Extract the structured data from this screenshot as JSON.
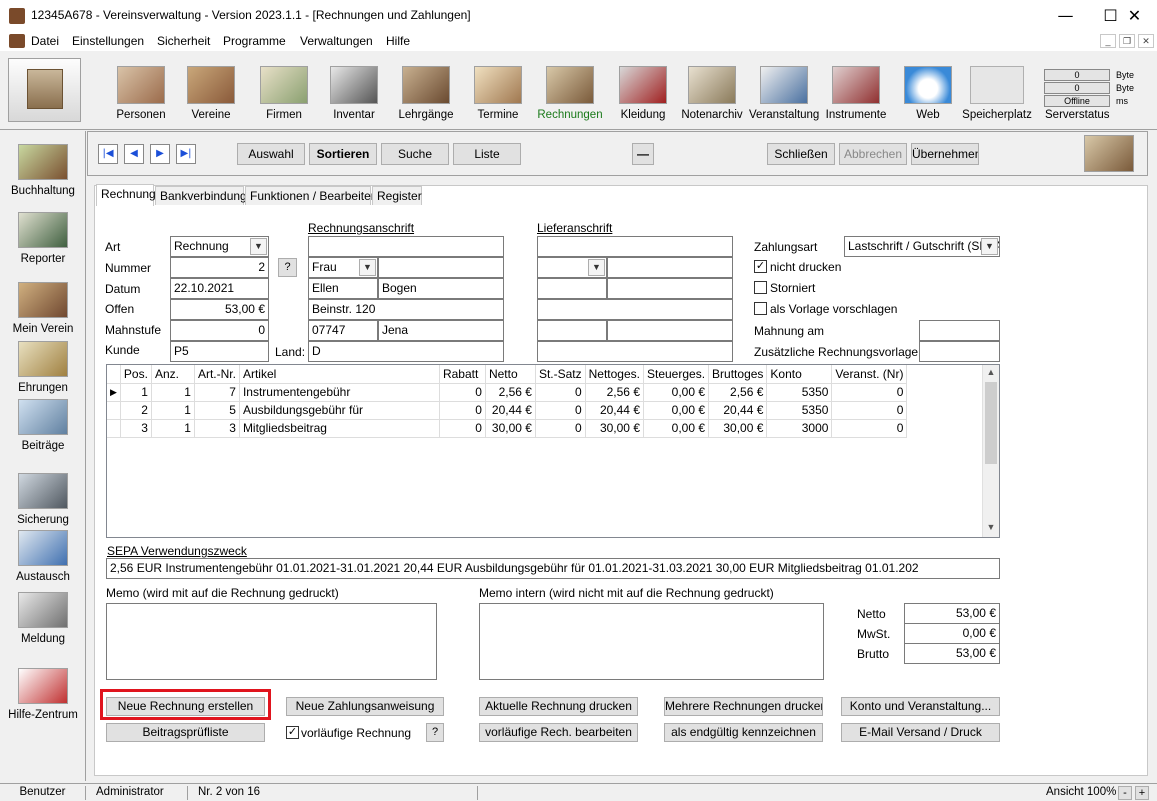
{
  "window": {
    "title": "12345A678 - Vereinsverwaltung - Version 2023.1.1 - [Rechnungen und Zahlungen]",
    "minimize": "—",
    "maximize": "☐",
    "close": "✕"
  },
  "menu": {
    "items": [
      "Datei",
      "Einstellungen",
      "Sicherheit",
      "Programme",
      "Verwaltungen",
      "Hilfe"
    ]
  },
  "toolbar": {
    "items": [
      {
        "label": "Personen",
        "icon": "people-icon"
      },
      {
        "label": "Vereine",
        "icon": "group-icon"
      },
      {
        "label": "Firmen",
        "icon": "building-icon"
      },
      {
        "label": "Inventar",
        "icon": "inventory-icon"
      },
      {
        "label": "Lehrgänge",
        "icon": "course-icon"
      },
      {
        "label": "Termine",
        "icon": "calendar-icon"
      },
      {
        "label": "Rechnungen",
        "icon": "cash-register-icon"
      },
      {
        "label": "Kleidung",
        "icon": "clothing-icon"
      },
      {
        "label": "Notenarchiv",
        "icon": "sheet-music-icon"
      },
      {
        "label": "Veranstaltung",
        "icon": "event-icon"
      },
      {
        "label": "Instrumente",
        "icon": "instruments-icon"
      },
      {
        "label": "Web",
        "icon": "cloud-icon"
      },
      {
        "label": "Speicherplatz",
        "icon": "storage-icon"
      }
    ],
    "server": {
      "label": "Serverstatus",
      "val1": "0",
      "unit1": "Byte",
      "val2": "0",
      "unit2": "Byte",
      "val3": "Offline",
      "unit3": "ms"
    }
  },
  "sidebar": {
    "items": [
      {
        "label": "Buchhaltung",
        "icon": "accounting-icon"
      },
      {
        "label": "Reporter",
        "icon": "reporter-icon"
      },
      {
        "label": "Mein Verein",
        "icon": "club-icon"
      },
      {
        "label": "Ehrungen",
        "icon": "honors-icon"
      },
      {
        "label": "Beiträge",
        "icon": "fees-icon"
      },
      {
        "label": "Sicherung",
        "icon": "backup-icon"
      },
      {
        "label": "Austausch",
        "icon": "exchange-icon"
      },
      {
        "label": "Meldung",
        "icon": "report-icon"
      },
      {
        "label": "Hilfe-Zentrum",
        "icon": "ambulance-icon"
      }
    ]
  },
  "nav": {
    "first": "|◀",
    "prev": "◀",
    "next": "▶",
    "last": "▶|",
    "auswahl": "Auswahl",
    "sortieren": "Sortieren",
    "suche": "Suche",
    "liste": "Liste",
    "minus": "—",
    "schliessen": "Schließen",
    "abbrechen": "Abbrechen",
    "uebernehmen": "Übernehmen"
  },
  "tabs": [
    "Rechnung",
    "Bankverbindung",
    "Funktionen / Bearbeiten",
    "Register"
  ],
  "form": {
    "art_label": "Art",
    "art_value": "Rechnung",
    "nummer_label": "Nummer",
    "nummer_value": "2",
    "help": "?",
    "datum_label": "Datum",
    "datum_value": "22.10.2021",
    "offen_label": "Offen",
    "offen_value": "53,00 €",
    "mahnstufe_label": "Mahnstufe",
    "mahnstufe_value": "0",
    "kunde_label": "Kunde",
    "kunde_value": "P5",
    "land_label": "Land:",
    "land_value": "D",
    "rechnungsanschrift": "Rechnungsanschrift",
    "anrede": "Frau",
    "vorname": "Ellen",
    "nachname": "Bogen",
    "strasse": "Beinstr. 120",
    "plz": "07747",
    "ort": "Jena",
    "lieferanschrift": "Lieferanschrift",
    "zahlungsart_label": "Zahlungsart",
    "zahlungsart_value": "Lastschrift / Gutschrift (SEPA)",
    "nicht_drucken": "nicht drucken",
    "storniert": "Storniert",
    "vorlage": "als Vorlage vorschlagen",
    "mahnung_label": "Mahnung am",
    "zus_vorlage_label": "Zusätzliche Rechnungsvorlage"
  },
  "grid": {
    "headers": [
      "Pos.",
      "Anz.",
      "Art.-Nr.",
      "Artikel",
      "Rabatt",
      "Netto",
      "St.-Satz",
      "Nettoges.",
      "Steuerges.",
      "Bruttoges",
      "Konto",
      "Veranst. (Nr)"
    ],
    "rows": [
      [
        "1",
        "1",
        "7",
        "Instrumentengebühr",
        "0",
        "2,56 €",
        "0",
        "2,56 €",
        "0,00 €",
        "2,56 €",
        "5350",
        "0"
      ],
      [
        "2",
        "1",
        "5",
        "Ausbildungsgebühr für",
        "0",
        "20,44 €",
        "0",
        "20,44 €",
        "0,00 €",
        "20,44 €",
        "5350",
        "0"
      ],
      [
        "3",
        "1",
        "3",
        "Mitgliedsbeitrag",
        "0",
        "30,00 €",
        "0",
        "30,00 €",
        "0,00 €",
        "30,00 €",
        "3000",
        "0"
      ]
    ]
  },
  "sepa": {
    "label": "SEPA Verwendungszweck",
    "value": "2,56 EUR Instrumentengebühr 01.01.2021-31.01.2021 20,44 EUR Ausbildungsgebühr für 01.01.2021-31.03.2021 30,00 EUR Mitgliedsbeitrag 01.01.202"
  },
  "memo": {
    "label": "Memo (wird mit auf die Rechnung gedruckt)",
    "intern_label": "Memo intern (wird nicht mit auf die Rechnung gedruckt)"
  },
  "totals": {
    "netto_label": "Netto",
    "netto_value": "53,00 €",
    "mwst_label": "MwSt.",
    "mwst_value": "0,00 €",
    "brutto_label": "Brutto",
    "brutto_value": "53,00 €"
  },
  "actions": {
    "neue_rechnung": "Neue Rechnung erstellen",
    "neue_zahlung": "Neue Zahlungsanweisung",
    "aktuelle_drucken": "Aktuelle Rechnung drucken",
    "mehrere_drucken": "Mehrere Rechnungen drucken",
    "konto_veranst": "Konto und Veranstaltung...",
    "beitragspruefliste": "Beitragsprüfliste",
    "vorlaeufige": "vorläufige Rechnung",
    "help": "?",
    "vorl_bearbeiten": "vorläufige Rech. bearbeiten",
    "endgueltig": "als endgültig kennzeichnen",
    "email": "E-Mail Versand / Druck"
  },
  "statusbar": {
    "benutzer": "Benutzer",
    "user": "Administrator",
    "record": "Nr. 2 von 16",
    "ansicht": "Ansicht 100%",
    "minus": "-",
    "plus": "+"
  },
  "colors": {
    "highlight": "#e0141e",
    "active_tab_label": "#1a7a1a",
    "nav_arrow": "#1b4fd8"
  }
}
